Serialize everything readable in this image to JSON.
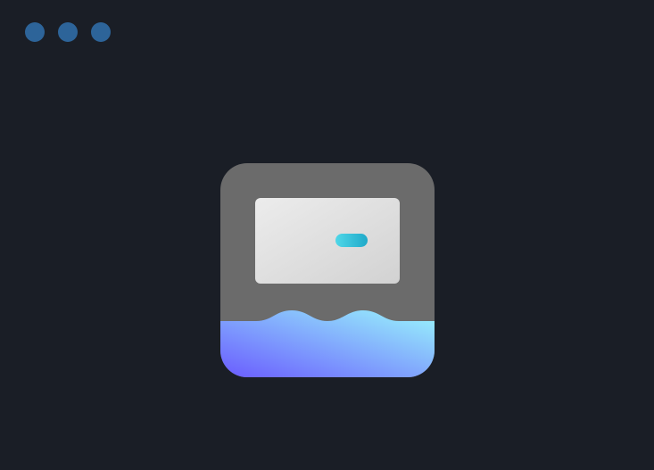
{
  "window": {
    "background": "#1a1e26",
    "controls": [
      {
        "name": "close",
        "color": "#2d6499"
      },
      {
        "name": "minimize",
        "color": "#2d6499"
      },
      {
        "name": "zoom",
        "color": "#2d6499"
      }
    ]
  },
  "app_icon": {
    "icon": "drive-icon",
    "colors": {
      "tile": "#6b6b6b",
      "panel_light": "#ececec",
      "panel_dark": "#d2d2d2",
      "indicator_start": "#4fd7e8",
      "indicator_end": "#1fa9c9",
      "wave_start": "#6a5cff",
      "wave_end": "#99f5fb"
    }
  }
}
